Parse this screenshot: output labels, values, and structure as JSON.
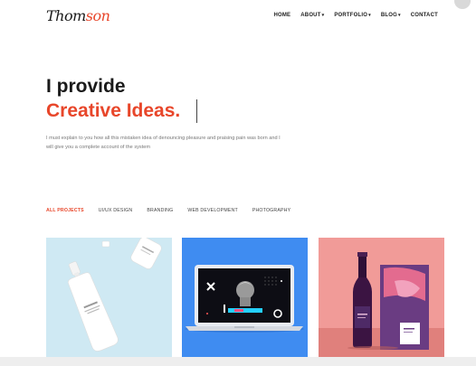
{
  "header": {
    "logo_part1": "Thom",
    "logo_part2": "son",
    "nav": [
      {
        "label": "HOME",
        "caret": ""
      },
      {
        "label": "ABOUT",
        "caret": "▾"
      },
      {
        "label": "PORTFOLIO",
        "caret": "▾"
      },
      {
        "label": "BLOG",
        "caret": "▾"
      },
      {
        "label": "CONTACT",
        "caret": ""
      }
    ]
  },
  "hero": {
    "line1": "I provide",
    "line2": "Creative Ideas.",
    "description": "I must explain to you how all this mistaken idea of denouncing pleasure and praising pain was born and I will give you a complete account of the system"
  },
  "filters": [
    "ALL PROJECTS",
    "UI/UX DESIGN",
    "BRANDING",
    "WEB DEVELOPMENT",
    "PHOTOGRAPHY"
  ],
  "active_filter": "ALL PROJECTS",
  "colors": {
    "accent": "#e8462a",
    "card1_bg": "#cfe9f3",
    "card2_bg": "#3f8cf1",
    "card3_bg": "#f19b98"
  }
}
